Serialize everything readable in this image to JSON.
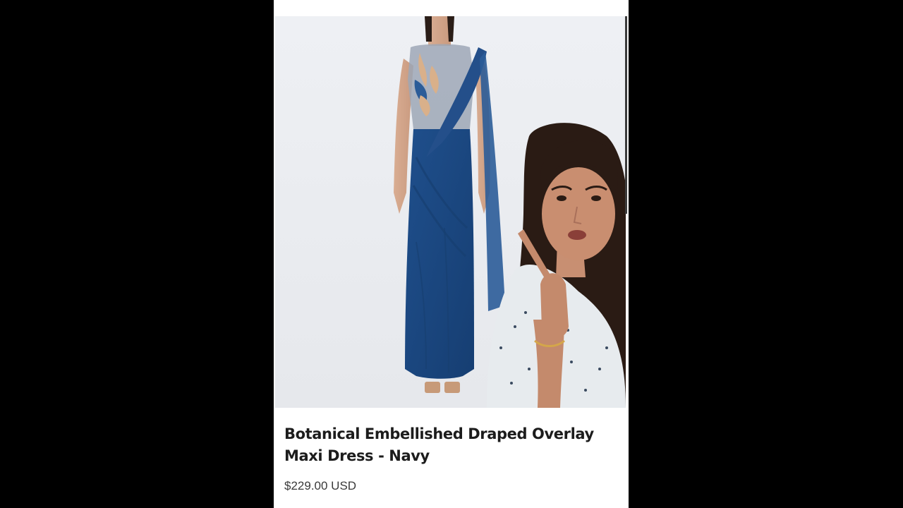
{
  "product": {
    "title": "Botanical Embellished Draped Overlay Maxi Dress - Navy",
    "price": "$229.00 USD"
  },
  "colors": {
    "background": "#000000",
    "page": "#ffffff",
    "image_backdrop": "#eceef2",
    "dress_navy": "#1f4f8c",
    "title_text": "#1c1c1c",
    "price_text": "#3a3a3a"
  },
  "icons": {
    "product_photo": "dress-model-photo",
    "presenter_overlay": "presenter-webcam-overlay"
  }
}
